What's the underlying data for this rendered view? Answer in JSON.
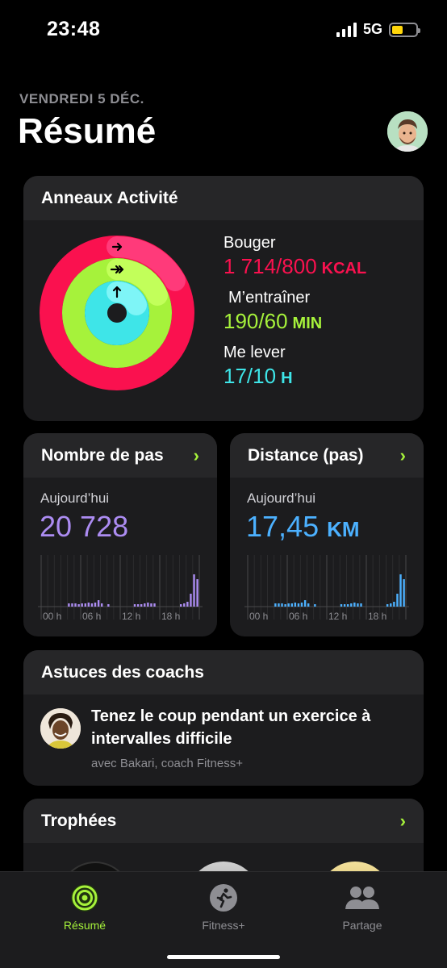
{
  "status_bar": {
    "time": "23:48",
    "network": "5G"
  },
  "header": {
    "date": "VENDREDI 5 DÉC.",
    "title": "Résumé"
  },
  "activity": {
    "title": "Anneaux Activité",
    "move": {
      "label": "Bouger",
      "value": "1 714/800",
      "unit": "KCAL",
      "progress": 2.14
    },
    "exercise": {
      "label": "M’entraîner",
      "value": "190/60",
      "unit": "MIN",
      "progress": 3.17
    },
    "stand": {
      "label": "Me lever",
      "value": "17/10",
      "unit": "H",
      "progress": 1.7
    },
    "colors": {
      "move": "#fa114f",
      "exercise": "#a6f23b",
      "stand": "#3ee5e8"
    }
  },
  "steps": {
    "title": "Nombre de pas",
    "today_label": "Aujourd’hui",
    "value": "20 728",
    "unit": "",
    "hourly": [
      0,
      0,
      0,
      0,
      0,
      0,
      0,
      0,
      0,
      0,
      0,
      0,
      0,
      0,
      0,
      0,
      0,
      0,
      0,
      0,
      0,
      0,
      0,
      0,
      0,
      0,
      0,
      0,
      0,
      0,
      0,
      0,
      0,
      0,
      0,
      0,
      0,
      0,
      0,
      0,
      0,
      0,
      0,
      0,
      0,
      0,
      0,
      0
    ],
    "axis_labels": [
      "00 h",
      "06 h",
      "12 h",
      "18 h"
    ]
  },
  "distance": {
    "title": "Distance (pas)",
    "today_label": "Aujourd’hui",
    "value": "17,45",
    "unit": "KM",
    "axis_labels": [
      "00 h",
      "06 h",
      "12 h",
      "18 h"
    ]
  },
  "tips": {
    "title": "Astuces des coachs",
    "text": "Tenez le coup pendant un exercice à intervalles difficile",
    "subtitle": "avec Bakari, coach Fitness+"
  },
  "trophies": {
    "title": "Trophées"
  },
  "tabs": [
    {
      "label": "Résumé",
      "icon": "activity-rings-icon",
      "active": true
    },
    {
      "label": "Fitness+",
      "icon": "runner-icon",
      "active": false
    },
    {
      "label": "Partage",
      "icon": "people-icon",
      "active": false
    }
  ]
}
